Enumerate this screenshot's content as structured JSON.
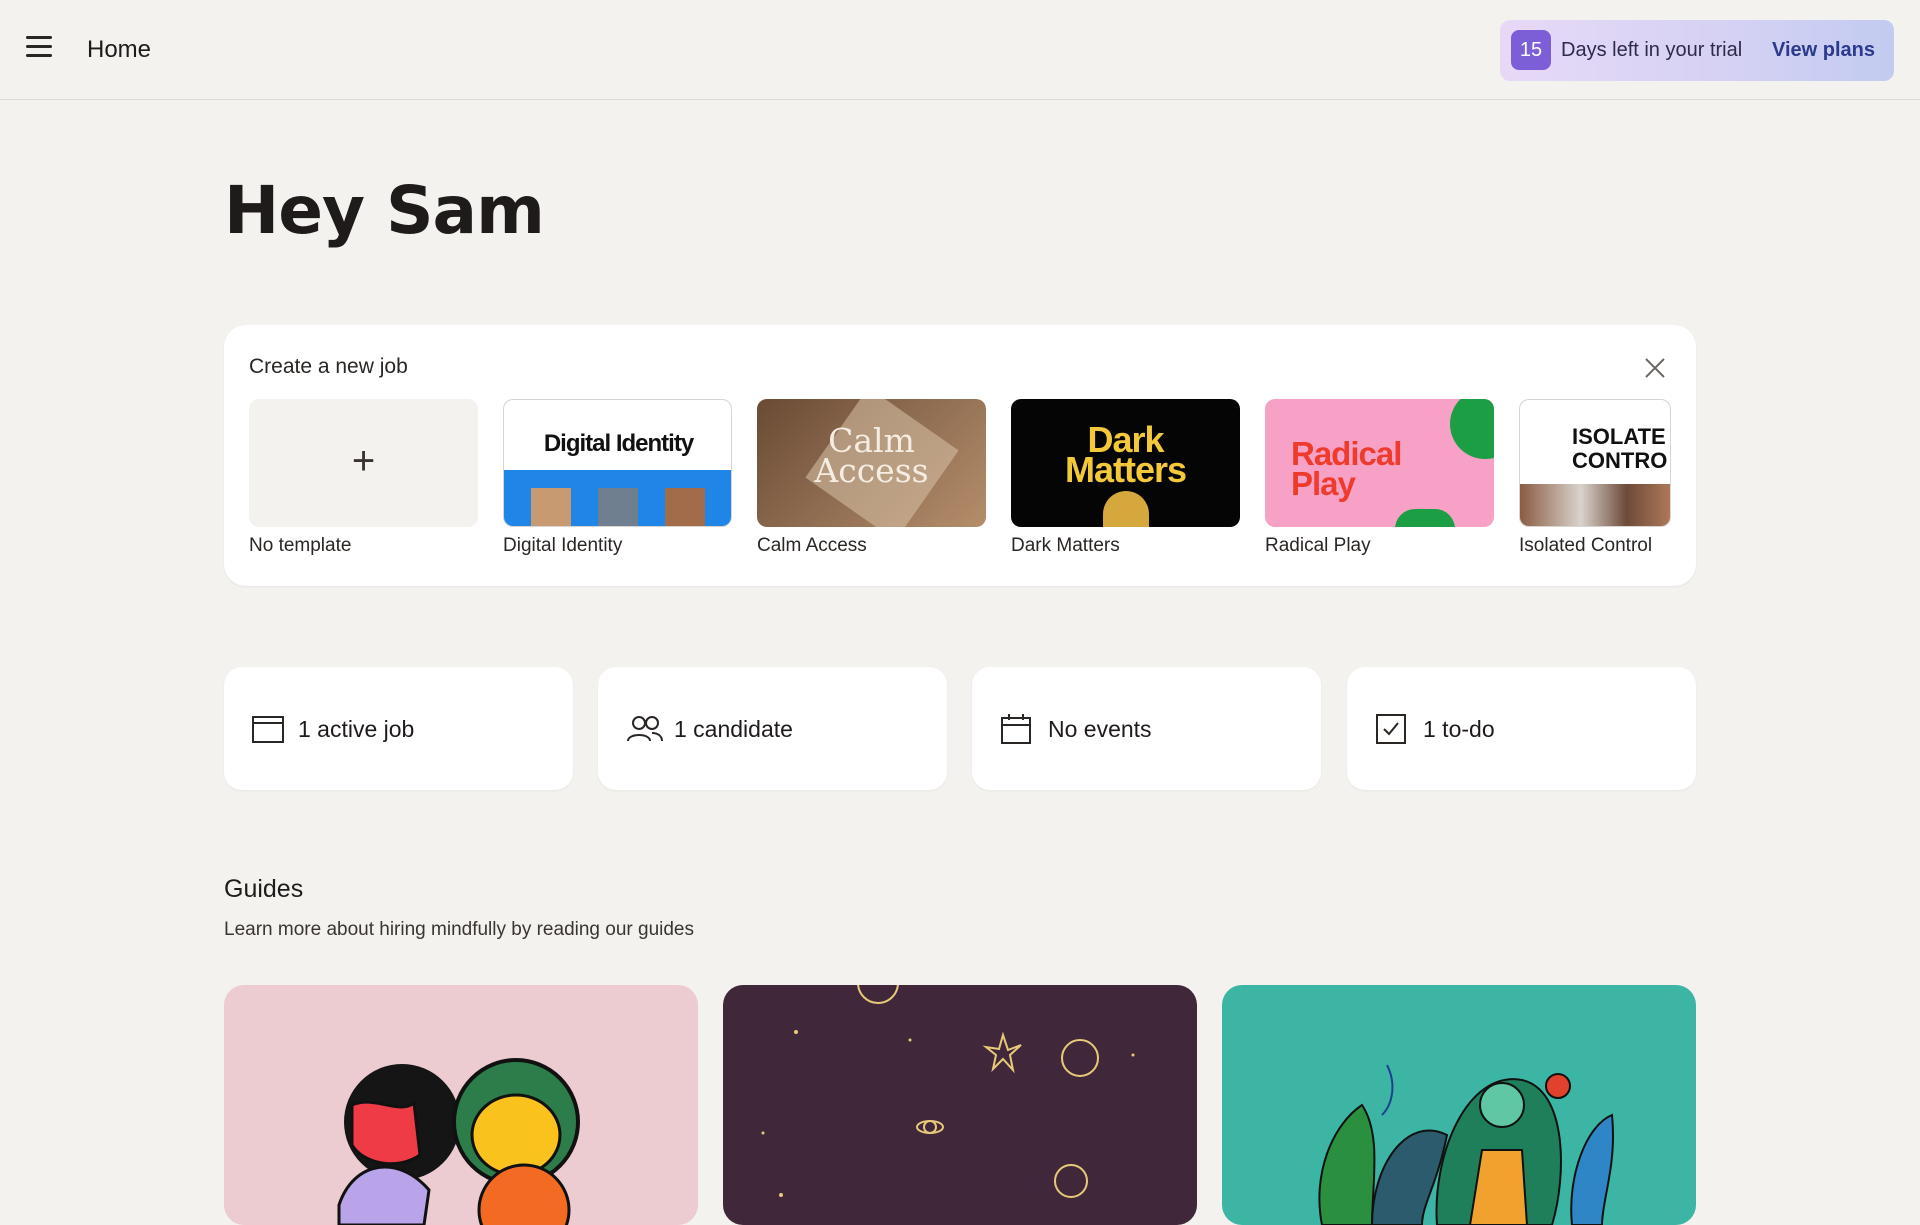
{
  "header": {
    "title": "Home",
    "trial": {
      "days": "15",
      "text": "Days left in your trial",
      "link": "View plans"
    }
  },
  "greeting": "Hey Sam",
  "create_job": {
    "title": "Create a new job",
    "templates": [
      {
        "label": "No template"
      },
      {
        "label": "Digital Identity",
        "thumb_text": "Digital Identity"
      },
      {
        "label": "Calm Access",
        "thumb_text_1": "Calm",
        "thumb_text_2": "Access"
      },
      {
        "label": "Dark Matters",
        "thumb_text_1": "Dark",
        "thumb_text_2": "Matters"
      },
      {
        "label": "Radical Play",
        "thumb_text_1": "Radical",
        "thumb_text_2": "Play"
      },
      {
        "label": "Isolated Control",
        "thumb_text_1": "ISOLATE",
        "thumb_text_2": "CONTRO"
      }
    ]
  },
  "stats": [
    {
      "label": "1 active job",
      "icon": "browser-window-icon"
    },
    {
      "label": "1 candidate",
      "icon": "users-icon"
    },
    {
      "label": "No events",
      "icon": "calendar-icon"
    },
    {
      "label": "1 to-do",
      "icon": "checkbox-icon"
    }
  ],
  "guides": {
    "title": "Guides",
    "subtitle": "Learn more about hiring mindfully by reading our guides"
  },
  "colors": {
    "background": "#f4f2ee",
    "trial_badge": "#7c5fd6",
    "trial_link": "#2b3a8c",
    "digital_identity_blue": "#1f86e8",
    "dark_matters_yellow": "#f3c93a",
    "radical_play_pink": "#f7a1c7",
    "radical_play_red": "#ef3b2c",
    "guide_pink": "#ecccd0",
    "guide_purple": "#40283a",
    "guide_teal": "#3db5a5"
  }
}
